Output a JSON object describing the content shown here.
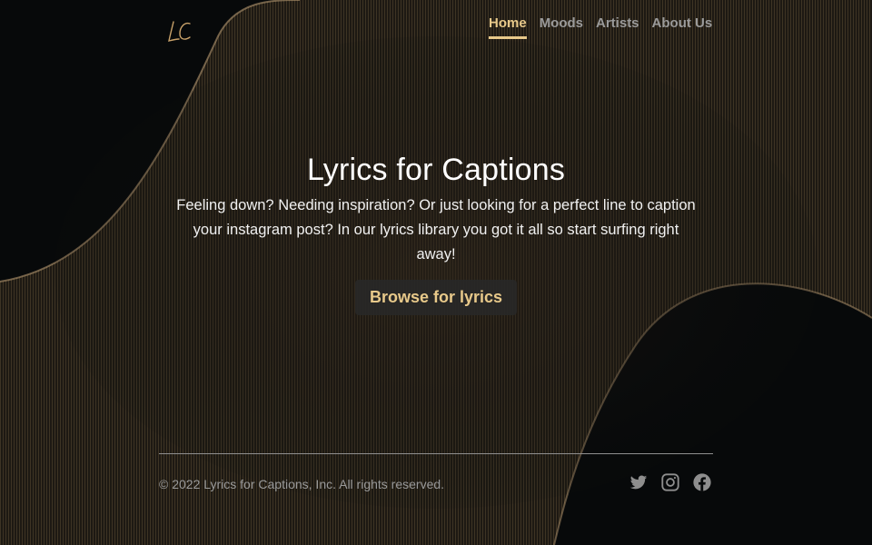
{
  "brand": {
    "logo_text": "LC"
  },
  "nav": {
    "items": [
      {
        "label": "Home",
        "active": true
      },
      {
        "label": "Moods",
        "active": false
      },
      {
        "label": "Artists",
        "active": false
      },
      {
        "label": "About Us",
        "active": false
      }
    ]
  },
  "hero": {
    "title": "Lyrics for Captions",
    "description": "Feeling down? Needing inspiration? Or just looking for a perfect line to caption your instagram post? In our lyrics library you got it all so start surfing right away!",
    "cta_label": "Browse for lyrics"
  },
  "footer": {
    "copyright": "© 2022 Lyrics for Captions, Inc. All rights reserved.",
    "social_icons": [
      "twitter-icon",
      "instagram-icon",
      "facebook-icon"
    ]
  },
  "colors": {
    "accent": "#e8c98a",
    "background": "#07090a",
    "muted_text": "#9a9a9a",
    "button_bg": "#282828"
  }
}
